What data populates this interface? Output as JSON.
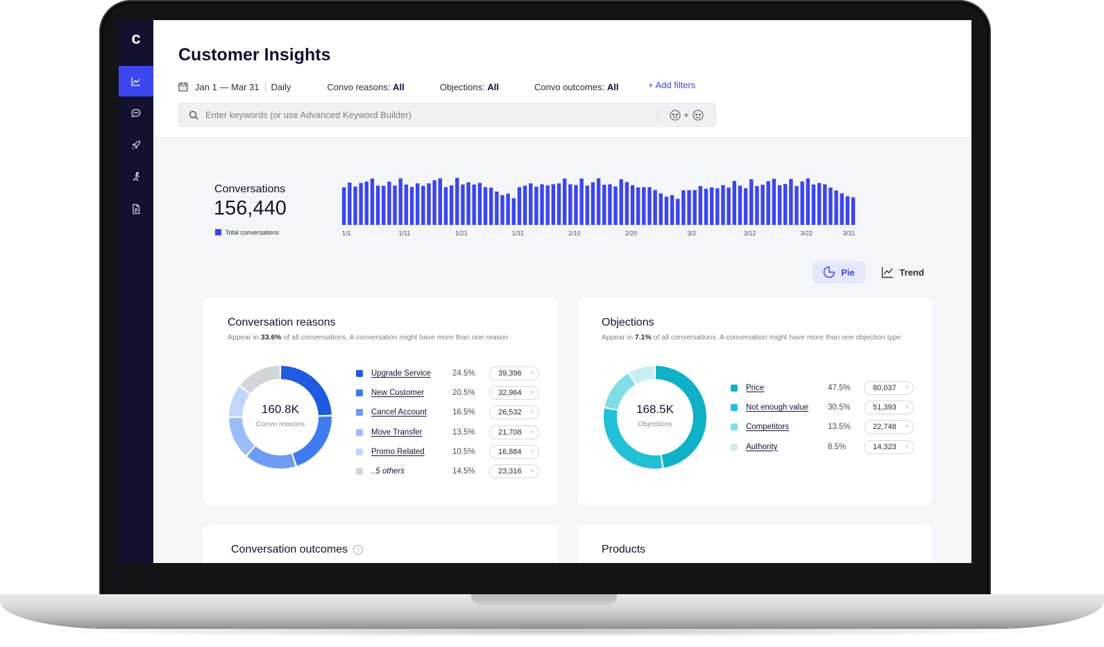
{
  "app": {
    "logo": "c"
  },
  "sidebar": {
    "items": [
      {
        "icon": "line-chart-icon",
        "active": true
      },
      {
        "icon": "chat-bubble-icon",
        "active": false
      },
      {
        "icon": "rocket-icon",
        "active": false
      },
      {
        "icon": "runner-icon",
        "active": false
      },
      {
        "icon": "document-icon",
        "active": false
      }
    ]
  },
  "header": {
    "title": "Customer Insights",
    "date_range": "Jan 1 — Mar 31",
    "granularity": "Daily",
    "filters": [
      {
        "label": "Convo reasons:",
        "value": "All"
      },
      {
        "label": "Objections:",
        "value": "All"
      },
      {
        "label": "Convo outcomes:",
        "value": "All"
      }
    ],
    "add_filters": "+  Add filters",
    "search_placeholder": "Enter keywords (or use Advanced Keyword Builder)"
  },
  "summary": {
    "label": "Conversations",
    "total": "156,440",
    "legend": "Total conversations"
  },
  "chart_data": {
    "type": "bar",
    "legend": [
      "Total conversations"
    ],
    "x_tick_labels": [
      "1/1",
      "1/11",
      "1/21",
      "1/31",
      "2/10",
      "2/20",
      "3/2",
      "3/12",
      "3/22",
      "3/31"
    ],
    "x": [
      "1/1",
      "1/2",
      "1/3",
      "1/4",
      "1/5",
      "1/6",
      "1/7",
      "1/8",
      "1/9",
      "1/10",
      "1/11",
      "1/12",
      "1/13",
      "1/14",
      "1/15",
      "1/16",
      "1/17",
      "1/18",
      "1/19",
      "1/20",
      "1/21",
      "1/22",
      "1/23",
      "1/24",
      "1/25",
      "1/26",
      "1/27",
      "1/28",
      "1/29",
      "1/30",
      "1/31",
      "2/1",
      "2/2",
      "2/3",
      "2/4",
      "2/5",
      "2/6",
      "2/7",
      "2/8",
      "2/9",
      "2/10",
      "2/11",
      "2/12",
      "2/13",
      "2/14",
      "2/15",
      "2/16",
      "2/17",
      "2/18",
      "2/19",
      "2/20",
      "2/21",
      "2/22",
      "2/23",
      "2/24",
      "2/25",
      "2/26",
      "2/27",
      "2/28",
      "2/29",
      "3/1",
      "3/2",
      "3/3",
      "3/4",
      "3/5",
      "3/6",
      "3/7",
      "3/8",
      "3/9",
      "3/10",
      "3/11",
      "3/12",
      "3/13",
      "3/14",
      "3/15",
      "3/16",
      "3/17",
      "3/18",
      "3/19",
      "3/20",
      "3/21",
      "3/22",
      "3/23",
      "3/24",
      "3/25",
      "3/26",
      "3/27",
      "3/28",
      "3/29",
      "3/30",
      "3/31"
    ],
    "values": [
      1700,
      1920,
      1740,
      1900,
      1960,
      2100,
      1780,
      1770,
      1960,
      1780,
      2110,
      1830,
      1720,
      1880,
      1770,
      1880,
      2020,
      2110,
      1710,
      1790,
      2130,
      1830,
      1930,
      1830,
      1900,
      1710,
      1690,
      1510,
      1350,
      1420,
      1210,
      1710,
      1780,
      1880,
      1730,
      1840,
      1790,
      1840,
      1880,
      2100,
      1840,
      1810,
      2100,
      1780,
      1930,
      2110,
      1820,
      1840,
      1740,
      2070,
      1940,
      1800,
      1700,
      1710,
      1710,
      1580,
      1430,
      1280,
      1350,
      1180,
      1570,
      1570,
      1580,
      1760,
      1640,
      1700,
      1660,
      1800,
      1690,
      1990,
      1780,
      1660,
      2070,
      1760,
      1820,
      1980,
      2090,
      1800,
      1850,
      2080,
      1760,
      1970,
      2110,
      1830,
      1900,
      1840,
      1690,
      1560,
      1430,
      1300,
      1250
    ],
    "ylim": [
      0,
      2200
    ]
  },
  "toggle": {
    "pie_label": "Pie",
    "trend_label": "Trend",
    "selected": "Pie"
  },
  "cards": {
    "reasons": {
      "title": "Conversation reasons",
      "subtitle_prefix": "Appear in ",
      "subtitle_pct": "33.6%",
      "subtitle_suffix": " of all conversations. A conversation might have more than one reason",
      "center_value": "160.8K",
      "center_label": "Convo reasons",
      "items": [
        {
          "name": "Upgrade Service",
          "pct": "24.5%",
          "count": "39,396",
          "color": "#1f5ae0"
        },
        {
          "name": "New Customer",
          "pct": "20.5%",
          "count": "32,964",
          "color": "#3f7cf0"
        },
        {
          "name": "Cancel Account",
          "pct": "16.5%",
          "count": "26,532",
          "color": "#6f9cf4"
        },
        {
          "name": "Move Transfer",
          "pct": "13.5%",
          "count": "21,708",
          "color": "#9bbcf7"
        },
        {
          "name": "Promo Related",
          "pct": "10.5%",
          "count": "16,884",
          "color": "#c3d6fa"
        },
        {
          "name": "..5 others",
          "pct": "14.5%",
          "count": "23,316",
          "color": "#d2d6da"
        }
      ]
    },
    "objections": {
      "title": "Objections",
      "subtitle_prefix": "Appear in ",
      "subtitle_pct": "7.1%",
      "subtitle_suffix": " of all conversations. A conversation might have more than one objection type",
      "center_value": "168.5K",
      "center_label": "Objections",
      "items": [
        {
          "name": "Price",
          "pct": "47.5%",
          "count": "80,037",
          "color": "#0fb1c6"
        },
        {
          "name": "Not enough value",
          "pct": "30.5%",
          "count": "51,393",
          "color": "#22c0d4"
        },
        {
          "name": "Competitors",
          "pct": "13.5%",
          "count": "22,748",
          "color": "#7fdde7"
        },
        {
          "name": "Authority",
          "pct": "8.5%",
          "count": "14,323",
          "color": "#c8eef2"
        }
      ]
    },
    "outcomes": {
      "title": "Conversation outcomes"
    },
    "products": {
      "title": "Products"
    }
  }
}
